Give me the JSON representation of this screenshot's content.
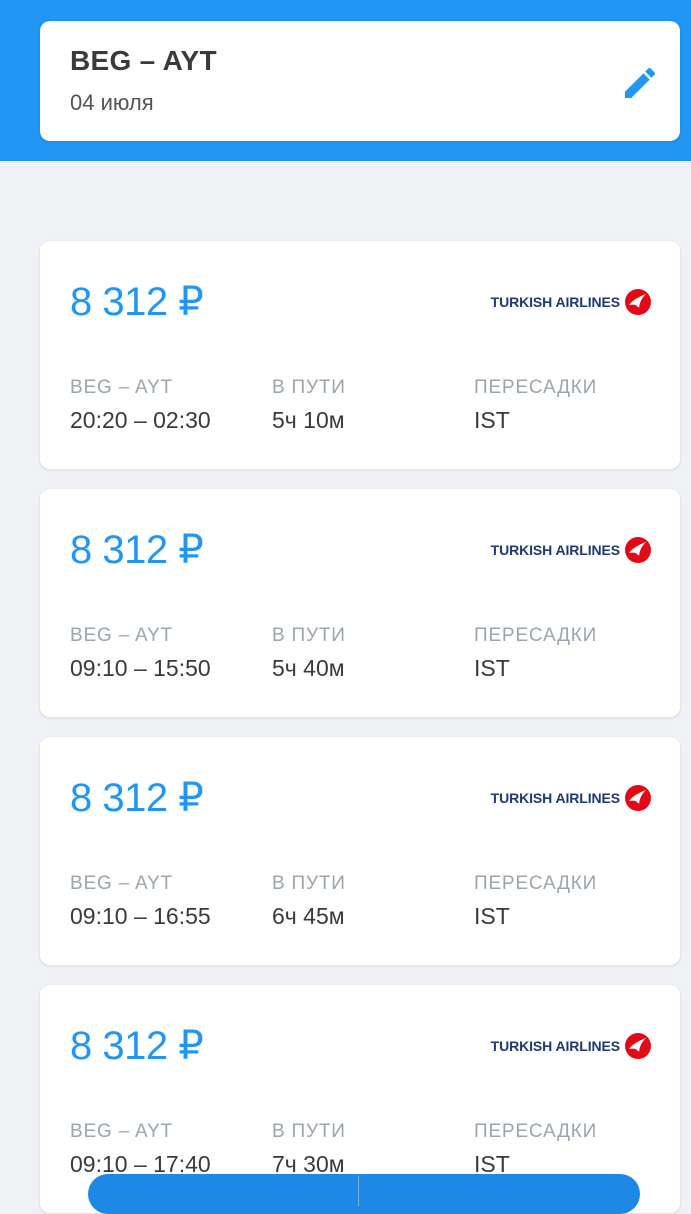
{
  "header": {
    "route": "BEG – AYT",
    "date": "04 июля"
  },
  "labels": {
    "route": "BEG – AYT",
    "duration": "В ПУТИ",
    "transfers": "ПЕРЕСАДКИ"
  },
  "tickets": [
    {
      "price": "8 312 ₽",
      "airline": "TURKISH AIRLINES",
      "times": "20:20 – 02:30",
      "duration": "5ч 10м",
      "transfers": "IST"
    },
    {
      "price": "8 312 ₽",
      "airline": "TURKISH AIRLINES",
      "times": "09:10 – 15:50",
      "duration": "5ч 40м",
      "transfers": "IST"
    },
    {
      "price": "8 312 ₽",
      "airline": "TURKISH AIRLINES",
      "times": "09:10 – 16:55",
      "duration": "6ч 45м",
      "transfers": "IST"
    },
    {
      "price": "8 312 ₽",
      "airline": "TURKISH AIRLINES",
      "times": "09:10 – 17:40",
      "duration": "7ч 30м",
      "transfers": "IST"
    }
  ],
  "colors": {
    "brand_blue": "#2196f3",
    "turkish_red": "#e30a17",
    "airline_text": "#1f3a73"
  },
  "icons": {
    "edit": "pencil-icon",
    "airline_logo": "turkish-airlines-logo-icon"
  }
}
